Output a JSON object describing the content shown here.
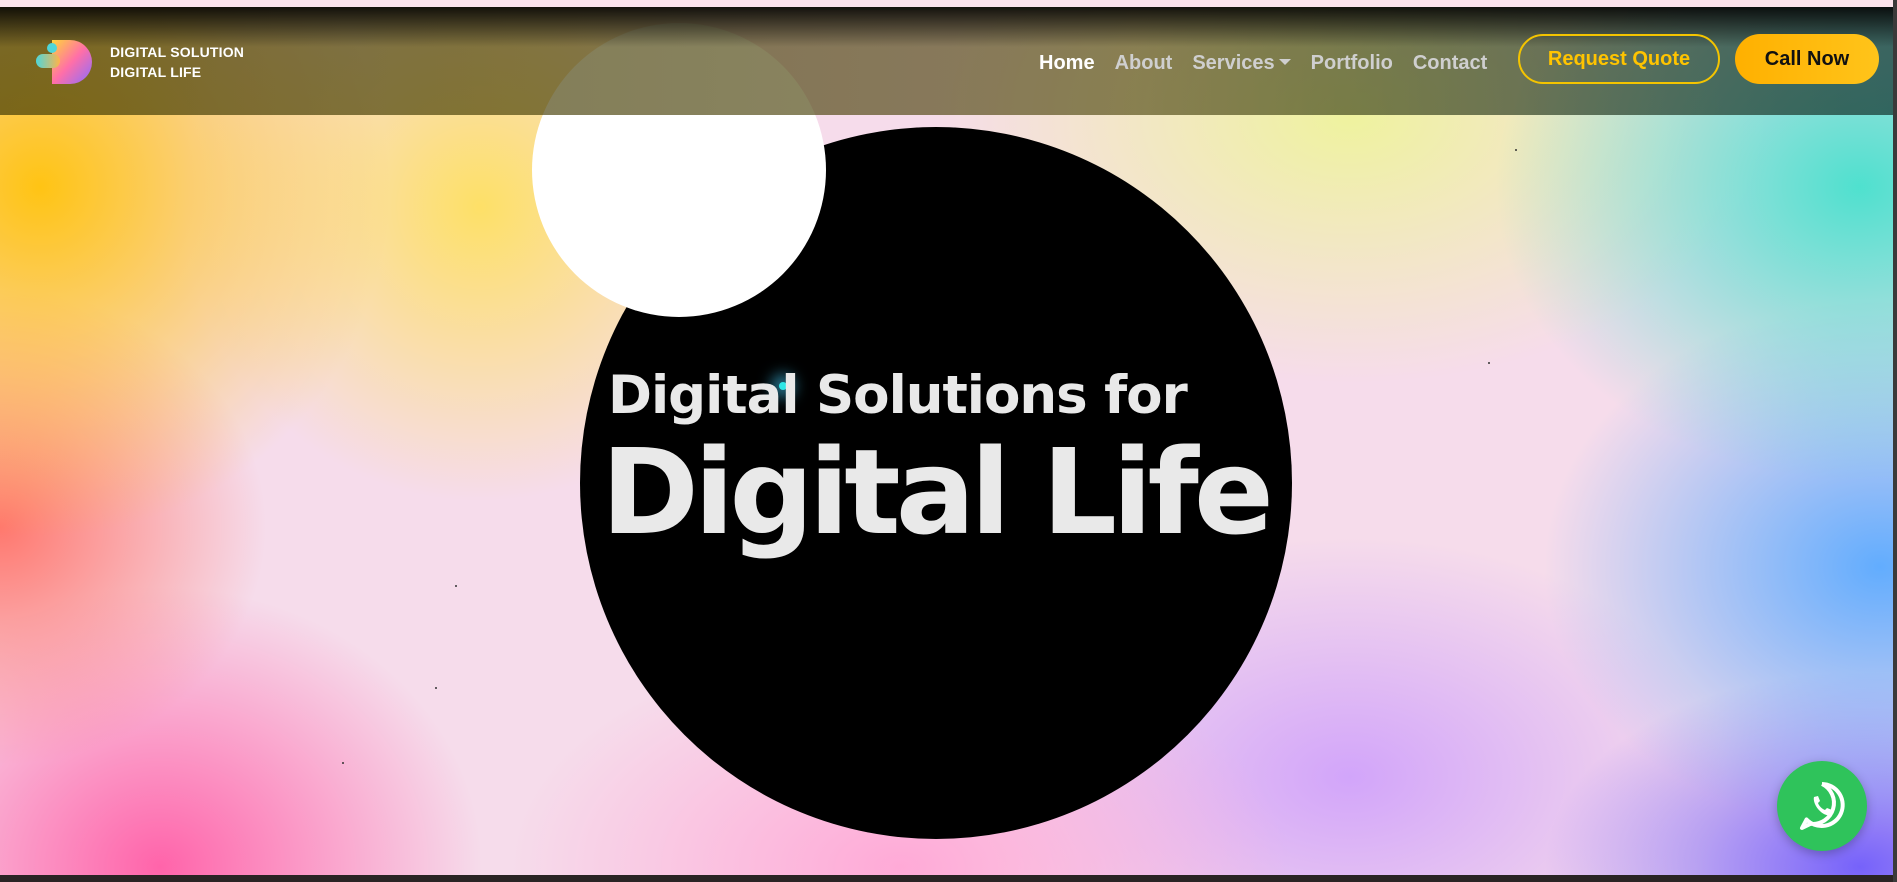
{
  "brand": {
    "line1": "DIGITAL SOLUTION",
    "line2": "DIGITAL LIFE",
    "logo_icon": "d-logo-icon"
  },
  "nav": {
    "items": [
      {
        "label": "Home",
        "active": true
      },
      {
        "label": "About",
        "active": false
      },
      {
        "label": "Services",
        "active": false,
        "dropdown": true
      },
      {
        "label": "Portfolio",
        "active": false
      },
      {
        "label": "Contact",
        "active": false
      }
    ],
    "quote_label": "Request Quote",
    "call_label": "Call Now"
  },
  "hero": {
    "line1": "Digital Solutions for",
    "line2": "Digital Life"
  },
  "floating": {
    "whatsapp_icon": "whatsapp-icon"
  },
  "colors": {
    "accent": "#ffc400",
    "call_button": "#ffb000",
    "whatsapp": "#2fc35b",
    "circle": "#000000"
  }
}
